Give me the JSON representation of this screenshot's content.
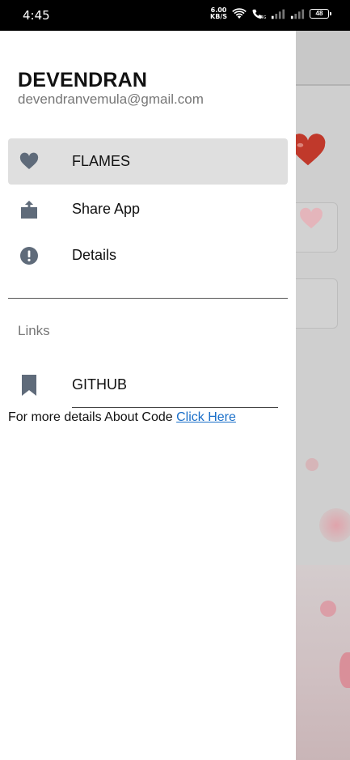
{
  "status_bar": {
    "time": "4:45",
    "net_speed_value": "6.00",
    "net_speed_unit": "KB/S",
    "battery": "48",
    "icons": [
      "wifi-icon",
      "volte-call-icon",
      "signal-icon",
      "signal-icon"
    ]
  },
  "drawer": {
    "profile": {
      "name": "DEVENDRAN",
      "email": "devendranvemula@gmail.com"
    },
    "menu": [
      {
        "label": "FLAMES",
        "icon": "heart-icon",
        "active": true
      },
      {
        "label": "Share App",
        "icon": "share-icon",
        "active": false
      },
      {
        "label": "Details",
        "icon": "info-icon",
        "active": false
      }
    ],
    "links_section": {
      "header": "Links",
      "items": [
        {
          "label": "GITHUB",
          "icon": "bookmark-icon"
        }
      ]
    },
    "footer": {
      "text": "For more details About Code ",
      "link_text": "Click Here"
    }
  },
  "colors": {
    "accent_icon": "#5f6b7a",
    "active_item_bg": "#dfdfdf",
    "link": "#1a6fc9",
    "scrim": "#cfcfcf"
  }
}
